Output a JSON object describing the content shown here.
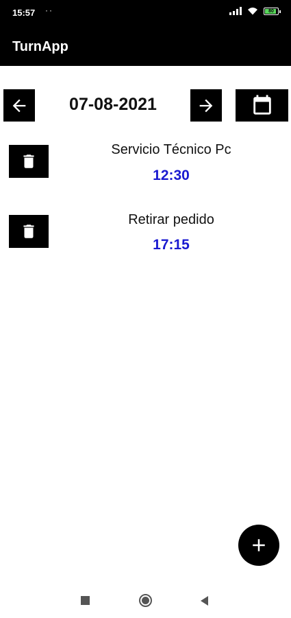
{
  "status_bar": {
    "time": "15:57",
    "dots": "··",
    "battery_label": "80"
  },
  "app_bar": {
    "title": "TurnApp"
  },
  "date_nav": {
    "date": "07-08-2021",
    "prev_icon": "arrow-left-icon",
    "next_icon": "arrow-right-icon",
    "calendar_icon": "calendar-icon"
  },
  "appointments": [
    {
      "title": "Servicio Técnico Pc",
      "time": "12:30"
    },
    {
      "title": "Retirar pedido",
      "time": "17:15"
    }
  ],
  "fab": {
    "icon": "plus-icon"
  },
  "colors": {
    "bar_background": "#000000",
    "time_text": "#1a1ad0",
    "battery_fill": "#59d85c"
  }
}
